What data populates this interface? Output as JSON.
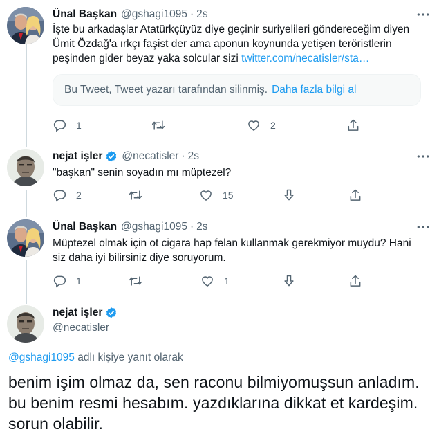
{
  "tweets": [
    {
      "name": "Ünal Başkan",
      "handle": "@gshagi1095",
      "time": "2s",
      "text": "İşte bu arkadaşlar Atatürkçüyüz diye geçinir suriyelileri göndereceğim diyen\nÜmit Özdağ'a ırkçı faşist der ama aponun koynunda yetişen teröristlerin\npeşinden gider beyaz yaka solcular sizi ",
      "link": "twitter.com/necatisler/sta…",
      "notice": "Bu Tweet, Tweet yazarı tarafından silinmiş.",
      "notice_link": "Daha fazla bilgi al",
      "replies": "1",
      "likes": "2"
    },
    {
      "name": "nejat işler",
      "handle": "@necatisler",
      "time": "2s",
      "text": "\"başkan\" senin soyadın mı  müptezel?",
      "replies": "2",
      "likes": "15"
    },
    {
      "name": "Ünal Başkan",
      "handle": "@gshagi1095",
      "time": "2s",
      "text": "Müptezel olmak için ot cigara hap felan kullanmak gerekmiyor muydu? Hani\nsiz daha iyi bilirsiniz diye soruyorum.",
      "replies": "1",
      "likes": "1"
    }
  ],
  "main_tweet": {
    "name": "nejat işler",
    "handle": "@necatisler",
    "reply_to_handle": "@gshagi1095",
    "reply_to_suffix": " adlı kişiye yanıt olarak",
    "text": "benim işim olmaz da, sen raconu bilmiyomuşsun anladım. bu benim resmi hesabım. yazdıklarına dikkat et kardeşim. sorun olabilir."
  },
  "colors": {
    "accent": "#1d9bf0",
    "secondary_text": "#536471",
    "primary_text": "#0f1419"
  },
  "icons": [
    "more-icon",
    "reply-icon",
    "retweet-icon",
    "like-icon",
    "share-icon",
    "download-icon",
    "verified-badge-icon"
  ]
}
